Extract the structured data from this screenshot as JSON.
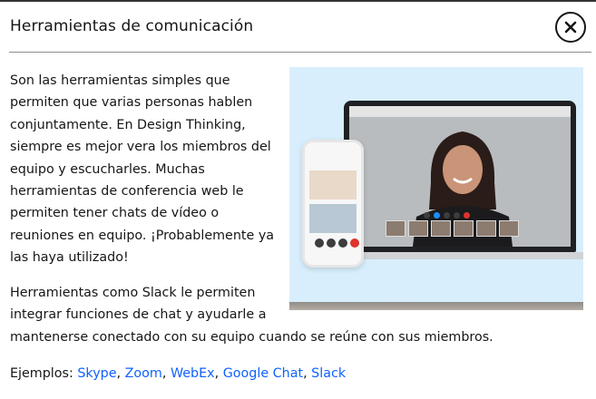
{
  "header": {
    "title": "Herramientas de comunicación",
    "close_icon": "close-icon"
  },
  "content": {
    "paragraph1_lines": [
      "Son las herramientas simples que",
      "permiten que varias personas hablen",
      "conjuntamente. En Design Thinking,",
      "siempre es mejor vera los miembros del",
      "equipo y escucharles. Muchas",
      "herramientas de conferencia web le",
      "permiten tener chats de vídeo o",
      "reuniones en equipo. ¡Probablemente ya",
      "las haya utilizado!"
    ],
    "paragraph2_lines": [
      "Herramientas como Slack le permiten",
      "integrar funciones de chat y ayudarle a",
      "mantenerse conectado con su equipo cuando se reúne con sus miembros."
    ],
    "examples_label": "Ejemplos: ",
    "examples": [
      "Skype",
      "Zoom",
      "WebEx",
      "Google Chat",
      "Slack"
    ],
    "separator": ", "
  },
  "colors": {
    "link": "#0f62fe",
    "text": "#161616",
    "illustration_bg": "#d8eefc"
  }
}
